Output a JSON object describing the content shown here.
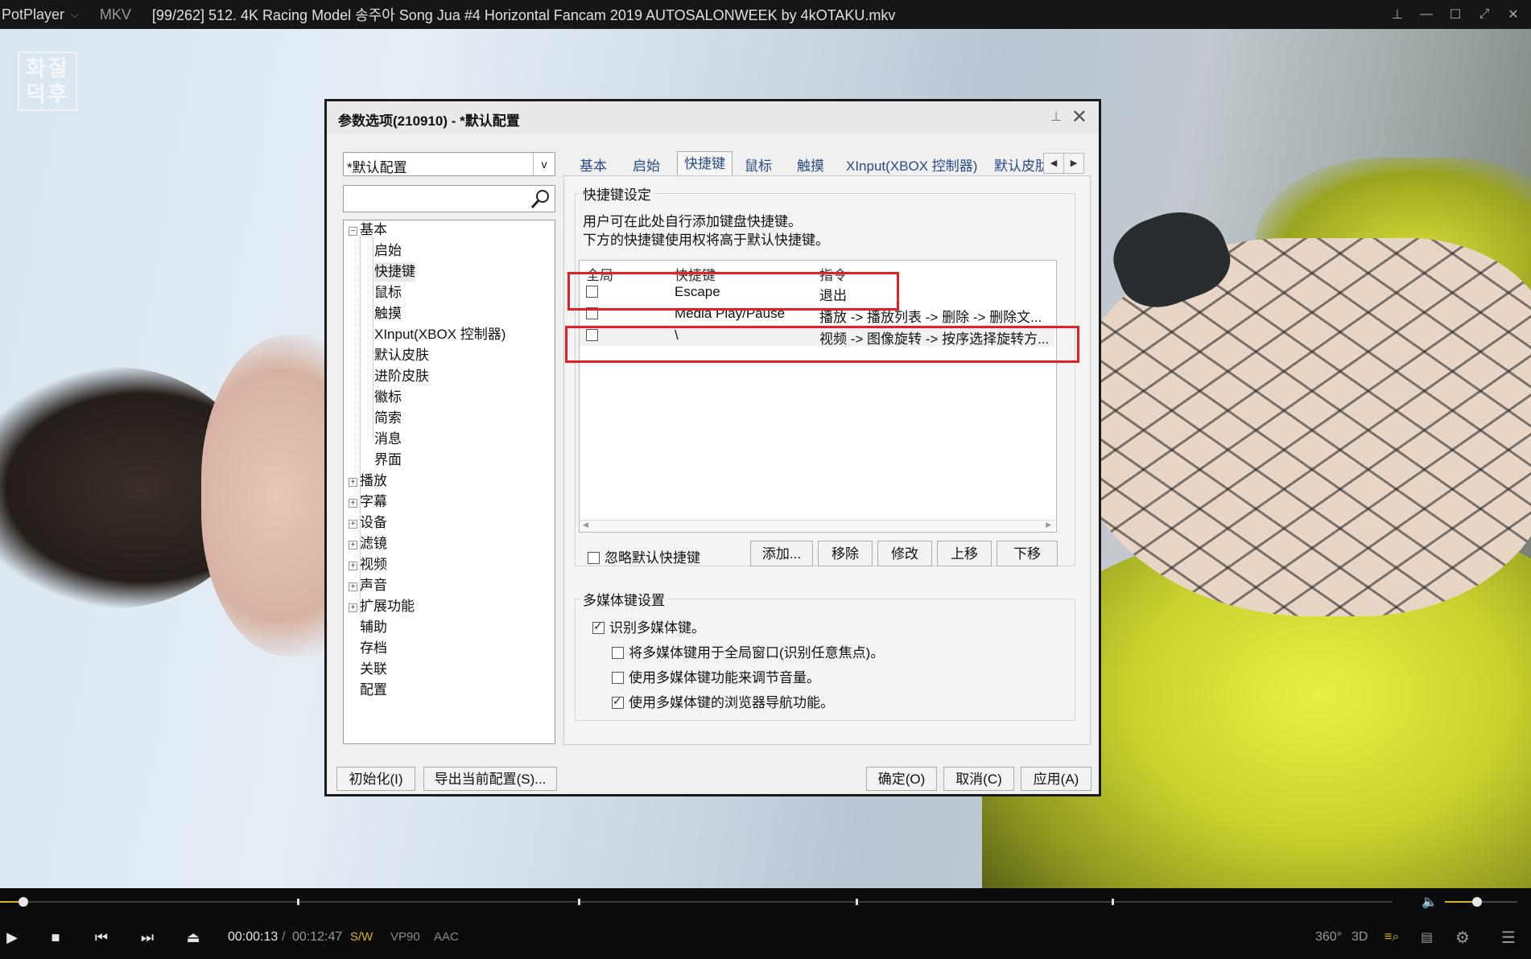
{
  "player": {
    "brand": "PotPlayer",
    "format": "MKV",
    "title": "[99/262] 512. 4K Racing Model 송주아 Song Jua #4 Horizontal Fancam 2019 AUTOSALONWEEK by 4kOTAKU.mkv",
    "watermark": "화질덕후",
    "time_current": "00:00:13",
    "time_sep": "/",
    "time_total": "00:12:47",
    "tags": [
      "S/W",
      "VP90",
      "AAC"
    ],
    "right_controls": [
      "360°",
      "3D"
    ],
    "seek_progress": 0.017,
    "volume": 0.44
  },
  "dialog": {
    "title": "参数选项(210910) - *默认配置",
    "profile": "*默认配置",
    "profile_arrow": "v",
    "search_placeholder": "",
    "tree": [
      {
        "label": "基本",
        "expanded": true
      },
      {
        "label": "启始"
      },
      {
        "label": "快捷键",
        "selected": true
      },
      {
        "label": "鼠标"
      },
      {
        "label": "触摸"
      },
      {
        "label": "XInput(XBOX 控制器)"
      },
      {
        "label": "默认皮肤"
      },
      {
        "label": "进阶皮肤"
      },
      {
        "label": "徽标"
      },
      {
        "label": "简索"
      },
      {
        "label": "消息"
      },
      {
        "label": "界面"
      },
      {
        "label": "播放"
      },
      {
        "label": "字幕"
      },
      {
        "label": "设备"
      },
      {
        "label": "滤镜"
      },
      {
        "label": "视频"
      },
      {
        "label": "声音"
      },
      {
        "label": "扩展功能"
      },
      {
        "label": "辅助"
      },
      {
        "label": "存档"
      },
      {
        "label": "关联"
      },
      {
        "label": "配置"
      }
    ],
    "tabs": [
      "基本",
      "启始",
      "快捷键",
      "鼠标",
      "触摸",
      "XInput(XBOX 控制器)",
      "默认皮肋"
    ],
    "active_tab": "快捷键",
    "hotkey_group": "快捷键设定",
    "desc1": "用户可在此处自行添加键盘快捷键。",
    "desc2": "下方的快捷键使用权将高于默认快捷键。",
    "columns": [
      "全局",
      "快捷键",
      "指令"
    ],
    "rows": [
      {
        "global": false,
        "key": "Escape",
        "command": "退出"
      },
      {
        "global": false,
        "key": "Media Play/Pause",
        "command": "播放 -> 播放列表 -> 删除 -> 删除文..."
      },
      {
        "global": false,
        "key": "\\",
        "command": "视频 -> 图像旋转 -> 按序选择旋转方..."
      }
    ],
    "ignore_default": "忽略默认快捷键",
    "buttons": {
      "add": "添加...",
      "remove": "移除",
      "modify": "修改",
      "up": "上移",
      "down": "下移"
    },
    "media_group": "多媒体键设置",
    "media_options": [
      {
        "label": "识别多媒体键。",
        "checked": true
      },
      {
        "label": "将多媒体键用于全局窗口(识别任意焦点)。",
        "checked": false
      },
      {
        "label": "使用多媒体键功能来调节音量。",
        "checked": false
      },
      {
        "label": "使用多媒体键的浏览器导航功能。",
        "checked": true
      }
    ],
    "footer": {
      "init": "初始化(I)",
      "export": "导出当前配置(S)...",
      "ok": "确定(O)",
      "cancel": "取消(C)",
      "apply": "应用(A)"
    }
  }
}
